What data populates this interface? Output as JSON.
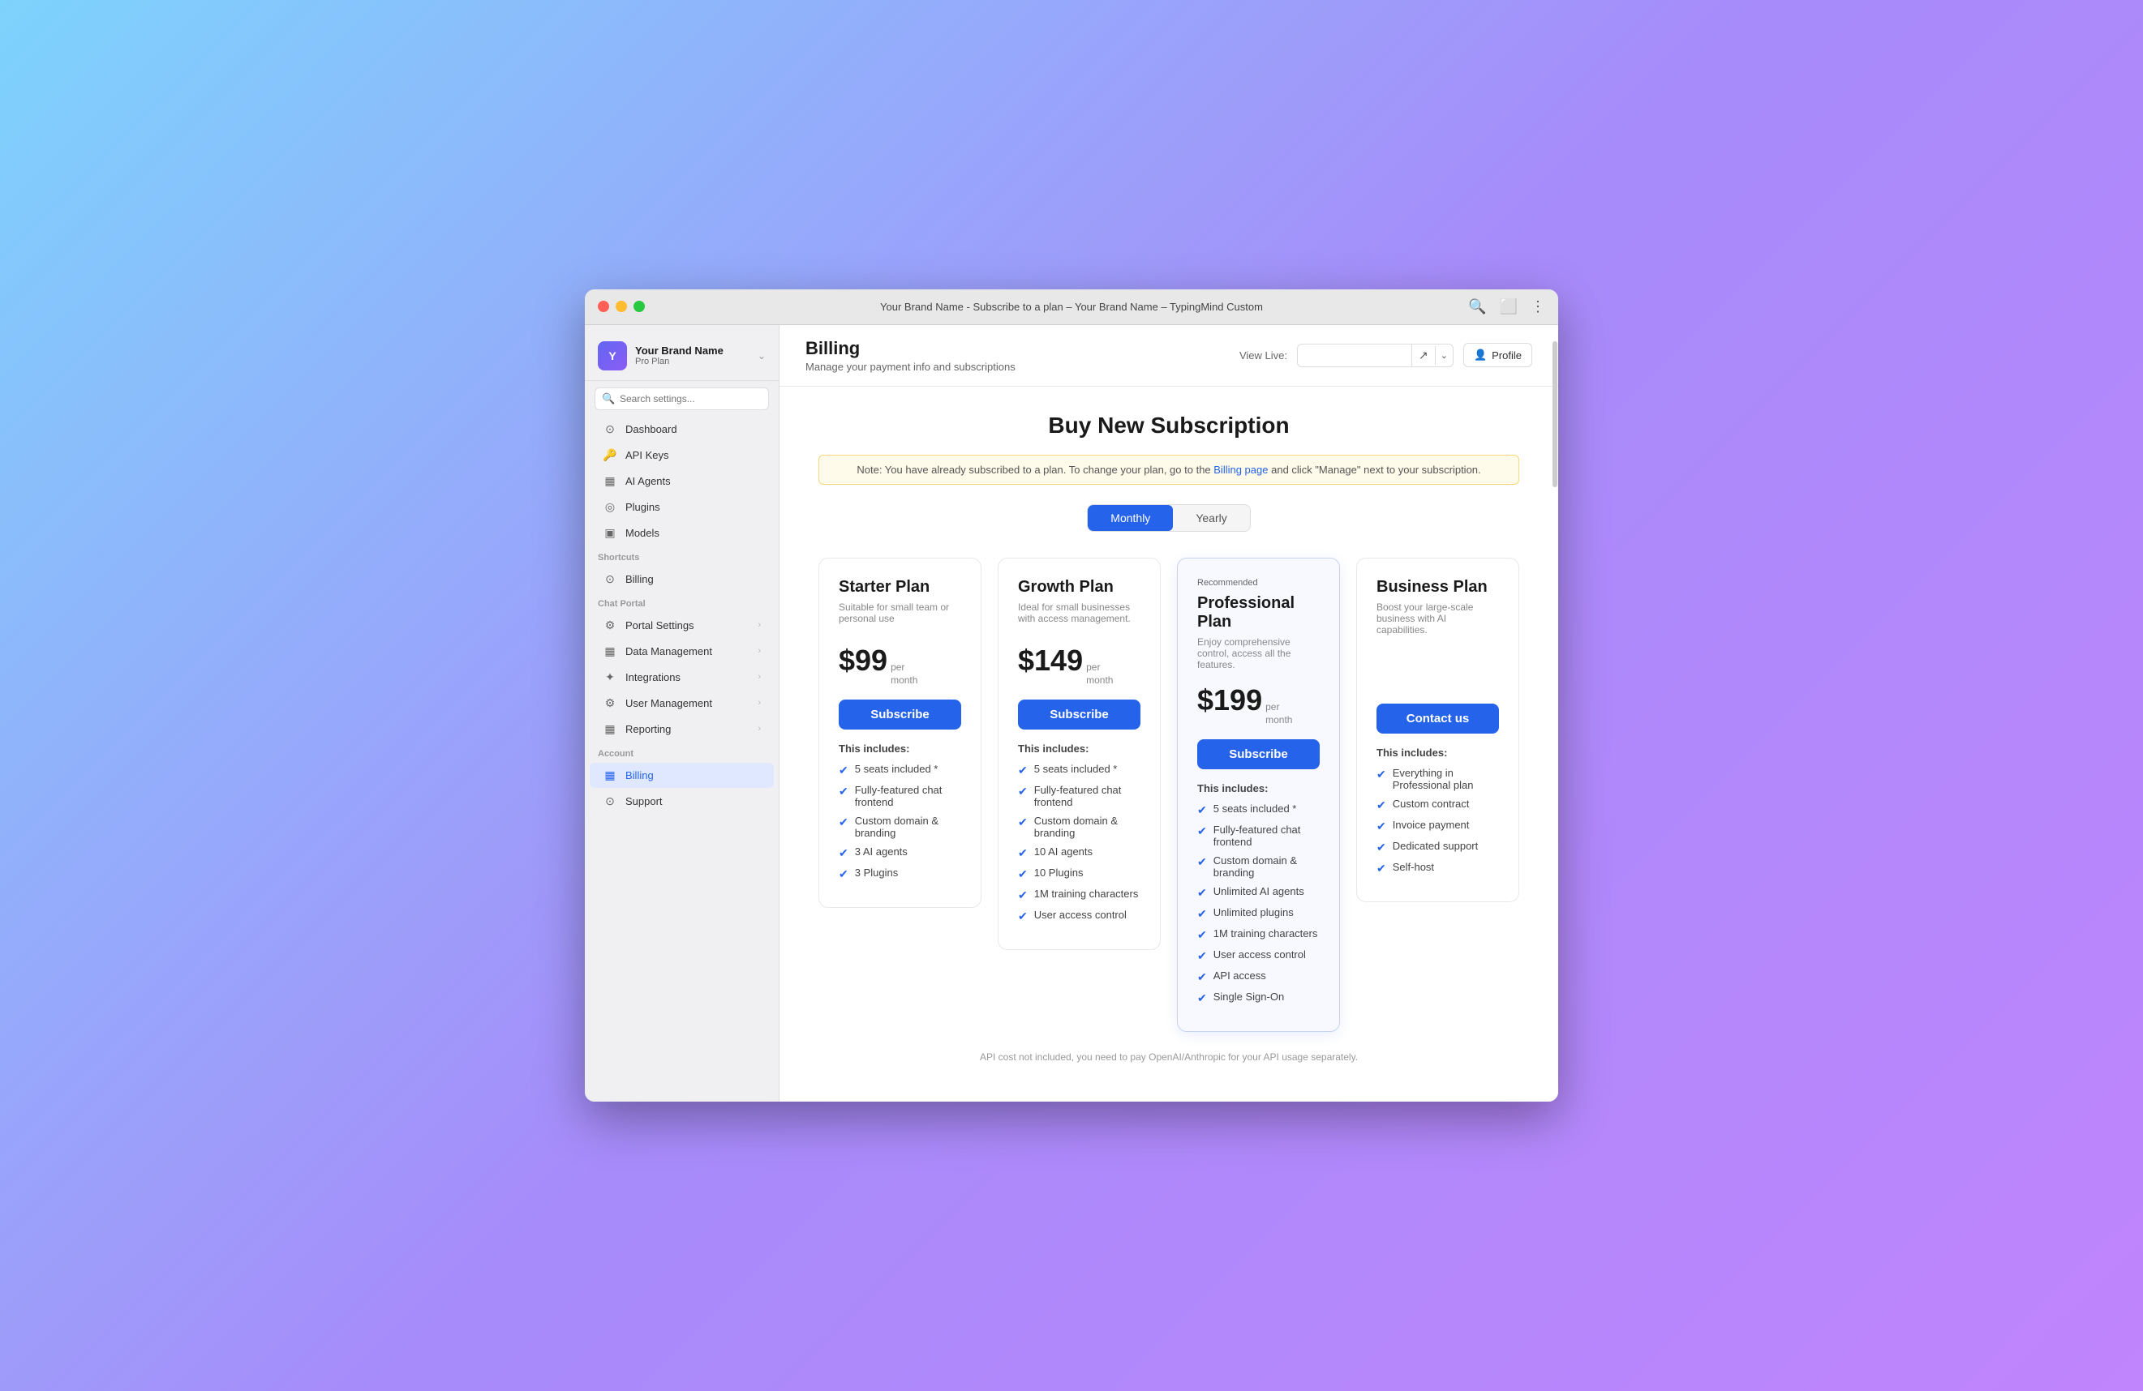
{
  "window": {
    "title": "Your Brand Name - Subscribe to a plan – Your Brand Name – TypingMind Custom"
  },
  "sidebar": {
    "brand": {
      "name": "Your Brand Name",
      "plan": "Pro Plan",
      "avatar_letter": "Y"
    },
    "search_placeholder": "Search settings...",
    "nav_items": [
      {
        "id": "dashboard",
        "icon": "⊙",
        "label": "Dashboard",
        "has_chevron": false
      },
      {
        "id": "api-keys",
        "icon": "🔑",
        "label": "API Keys",
        "has_chevron": false
      },
      {
        "id": "ai-agents",
        "icon": "▦",
        "label": "AI Agents",
        "has_chevron": false
      },
      {
        "id": "plugins",
        "icon": "◎",
        "label": "Plugins",
        "has_chevron": false
      },
      {
        "id": "models",
        "icon": "▣",
        "label": "Models",
        "has_chevron": false
      }
    ],
    "shortcuts_label": "Shortcuts",
    "shortcuts": [
      {
        "id": "billing-shortcut",
        "icon": "⊙",
        "label": "Billing",
        "has_chevron": false
      }
    ],
    "chat_portal_label": "Chat Portal",
    "chat_portal_items": [
      {
        "id": "portal-settings",
        "icon": "⚙",
        "label": "Portal Settings",
        "has_chevron": true
      },
      {
        "id": "data-management",
        "icon": "▦",
        "label": "Data Management",
        "has_chevron": true
      },
      {
        "id": "integrations",
        "icon": "✦",
        "label": "Integrations",
        "has_chevron": true
      },
      {
        "id": "user-management",
        "icon": "⚙",
        "label": "User Management",
        "has_chevron": true
      },
      {
        "id": "reporting",
        "icon": "▦",
        "label": "Reporting",
        "has_chevron": true
      }
    ],
    "account_label": "Account",
    "account_items": [
      {
        "id": "billing",
        "icon": "▦",
        "label": "Billing",
        "has_chevron": false,
        "active": true
      },
      {
        "id": "support",
        "icon": "⊙",
        "label": "Support",
        "has_chevron": false
      }
    ]
  },
  "header": {
    "title": "Billing",
    "subtitle": "Manage your payment info and subscriptions",
    "view_live_label": "View Live:",
    "view_live_placeholder": "",
    "profile_label": "Profile"
  },
  "billing": {
    "page_title": "Buy New Subscription",
    "notice": {
      "text_before": "Note: You have already subscribed to a plan. To change your plan, go to the ",
      "link_text": "Billing page",
      "text_after": " and click \"Manage\" next to your subscription."
    },
    "toggle": {
      "monthly_label": "Monthly",
      "yearly_label": "Yearly",
      "active": "monthly"
    },
    "plans": [
      {
        "id": "starter",
        "recommended": false,
        "recommended_label": "",
        "name": "Starter Plan",
        "description": "Suitable for small team or personal use",
        "price": "$99",
        "per": "per\nmonth",
        "cta_label": "Subscribe",
        "includes_label": "This includes:",
        "features": [
          "5 seats included *",
          "Fully-featured chat frontend",
          "Custom domain & branding",
          "3 AI agents",
          "3 Plugins"
        ]
      },
      {
        "id": "growth",
        "recommended": false,
        "recommended_label": "",
        "name": "Growth Plan",
        "description": "Ideal for small businesses with access management.",
        "price": "$149",
        "per": "per\nmonth",
        "cta_label": "Subscribe",
        "includes_label": "This includes:",
        "features": [
          "5 seats included *",
          "Fully-featured chat frontend",
          "Custom domain & branding",
          "10 AI agents",
          "10 Plugins",
          "1M training characters",
          "User access control"
        ]
      },
      {
        "id": "professional",
        "recommended": true,
        "recommended_label": "Recommended",
        "name": "Professional Plan",
        "description": "Enjoy comprehensive control, access all the features.",
        "price": "$199",
        "per": "per\nmonth",
        "cta_label": "Subscribe",
        "includes_label": "This includes:",
        "features": [
          "5 seats included *",
          "Fully-featured chat frontend",
          "Custom domain & branding",
          "Unlimited AI agents",
          "Unlimited plugins",
          "1M training characters",
          "User access control",
          "API access",
          "Single Sign-On"
        ]
      },
      {
        "id": "business",
        "recommended": false,
        "recommended_label": "",
        "name": "Business Plan",
        "description": "Boost your large-scale business with AI capabilities.",
        "price": "",
        "per": "",
        "cta_label": "Contact us",
        "includes_label": "This includes:",
        "features": [
          "Everything in Professional plan",
          "Custom contract",
          "Invoice payment",
          "Dedicated support",
          "Self-host"
        ]
      }
    ],
    "footer_note": "API cost not included, you need to pay OpenAI/Anthropic for your API usage separately."
  }
}
